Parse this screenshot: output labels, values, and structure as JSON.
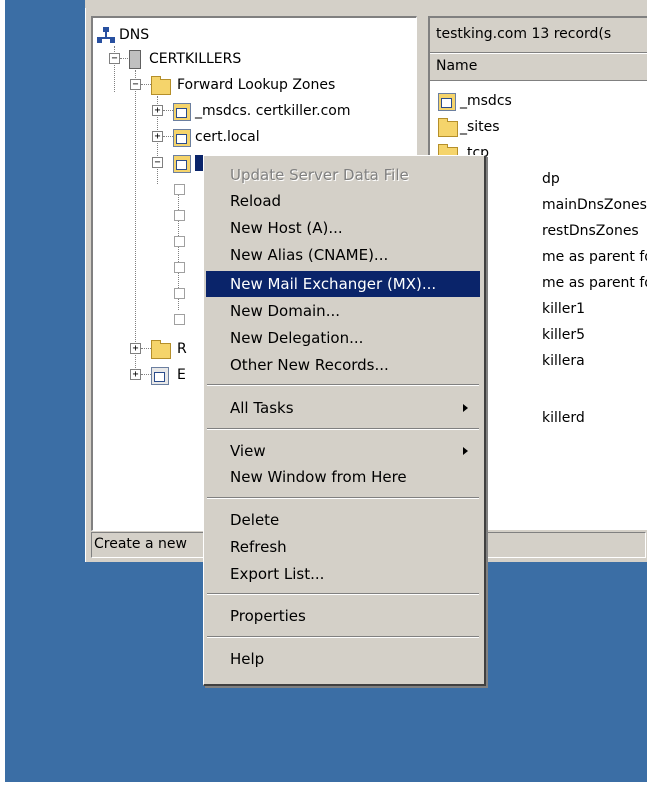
{
  "tree": {
    "root": "DNS",
    "server": "CERTKILLERS",
    "forward_zones": "Forward Lookup Zones",
    "zone1": "_msdcs. certkiller.com",
    "zone2": "cert.local",
    "reverse_letter": "R",
    "events_letter": "E"
  },
  "list": {
    "header": "testking.com   13 record(s",
    "column_name": "Name",
    "items": [
      "_msdcs",
      "_sites",
      "_tcp",
      "dp",
      "mainDnsZones",
      "restDnsZones",
      "me as parent folder)",
      "me as parent folder)",
      "killer1",
      "killer5",
      "killera",
      "killerd"
    ]
  },
  "status": "Create a new",
  "menu": {
    "items": [
      "Update Server Data File",
      "Reload",
      "New Host (A)...",
      "New Alias (CNAME)...",
      "New Mail Exchanger (MX)...",
      "New Domain...",
      "New Delegation...",
      "Other New Records...",
      "All Tasks",
      "View",
      "New Window from Here",
      "Delete",
      "Refresh",
      "Export List...",
      "Properties",
      "Help"
    ]
  },
  "colors": {
    "desktop": "#3b6ea5",
    "highlight": "#0a246a",
    "face": "#d4d0c8"
  }
}
